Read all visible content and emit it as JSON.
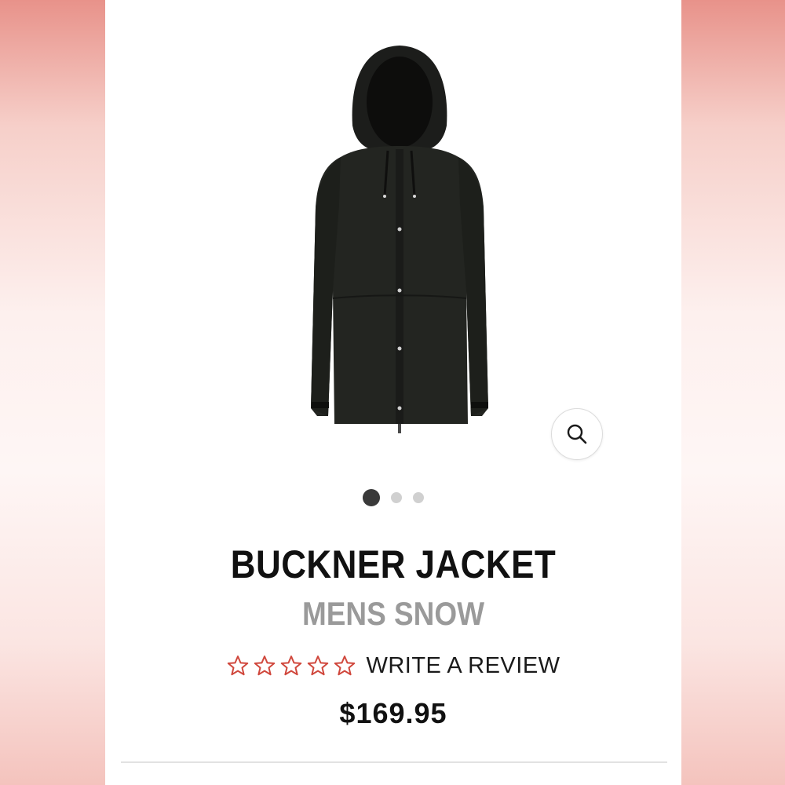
{
  "product": {
    "name": "BUCKNER JACKET",
    "category": "MENS SNOW",
    "review_link": "WRITE A REVIEW",
    "rating_stars": 5,
    "rating_filled": 0,
    "price": "$169.95"
  },
  "gallery": {
    "image_count": 3,
    "active_index": 0
  },
  "icons": {
    "zoom": "search-icon",
    "star": "star-outline-icon"
  },
  "colors": {
    "star_outline": "#d0473c",
    "title": "#111111",
    "subtitle": "#9a9a9a",
    "dot_active": "#3a3a3a",
    "dot_inactive": "#d0d0d0",
    "side_accent": "#e8928a"
  }
}
